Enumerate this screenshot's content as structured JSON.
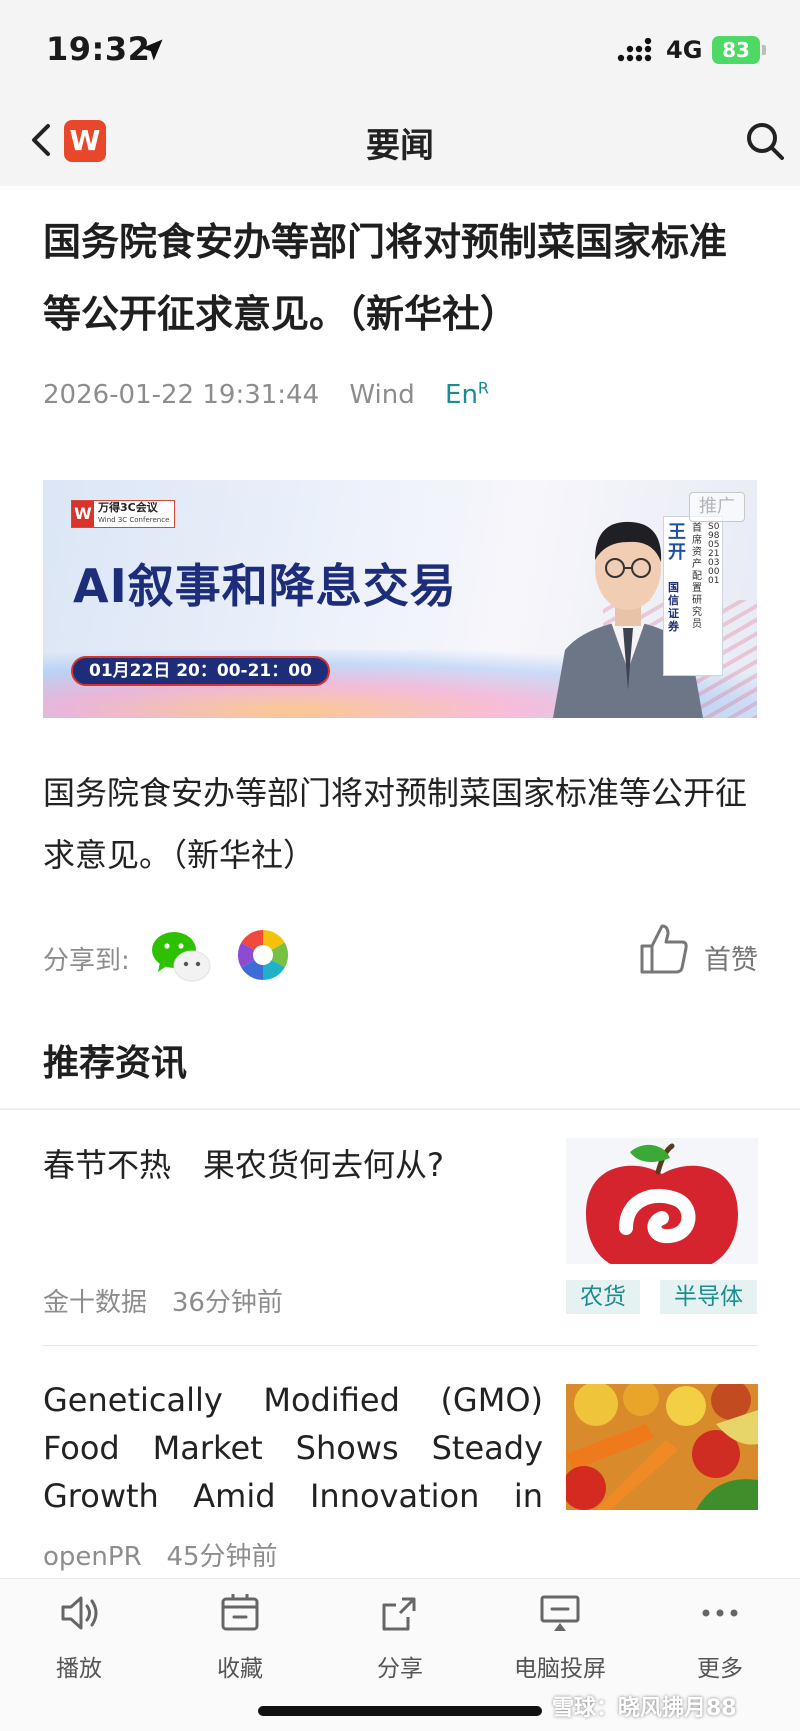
{
  "status_bar": {
    "time": "19:32",
    "network": "4G",
    "battery": "83"
  },
  "nav": {
    "logo": "W",
    "title": "要闻"
  },
  "article": {
    "headline": "国务院食安办等部门将对预制菜国家标准等公开征求意见。（新华社）",
    "datetime": "2026-01-22 19:31:44",
    "source": "Wind",
    "en_label": "En",
    "en_sup": "R",
    "body": "国务院食安办等部门将对预制菜国家标准等公开征求意见。（新华社）"
  },
  "banner": {
    "conf_logo": "W",
    "conf_name": "万得3C会议",
    "conf_en": "Wind 3C Conference",
    "title": "AI叙事和降息交易",
    "time": "01月22日 20：00-21：00",
    "ad_label": "推广",
    "speaker_name": "王开",
    "speaker_org": "国信证券",
    "speaker_role": "首席资产配置研究员",
    "speaker_id": "S0980521030001"
  },
  "share": {
    "label": "分享到:",
    "like_label": "首赞"
  },
  "recommend": {
    "title": "推荐资讯",
    "items": [
      {
        "title": "春节不热　果农货何去何从?",
        "source": "金十数据",
        "time": "36分钟前",
        "tags": [
          "农货",
          "半导体"
        ]
      },
      {
        "title": "Genetically Modified (GMO) Food Market Shows Steady Growth Amid Innovation in",
        "source": "openPR",
        "time": "45分钟前",
        "tags": []
      }
    ]
  },
  "toolbar": {
    "play": "播放",
    "favorite": "收藏",
    "share": "分享",
    "cast": "电脑投屏",
    "more": "更多"
  },
  "watermark": "雪球：晓风拂月88",
  "colors": {
    "accent_teal": "#1a8d8f",
    "brand_red": "#e8472a",
    "battery_green": "#4cd964"
  }
}
